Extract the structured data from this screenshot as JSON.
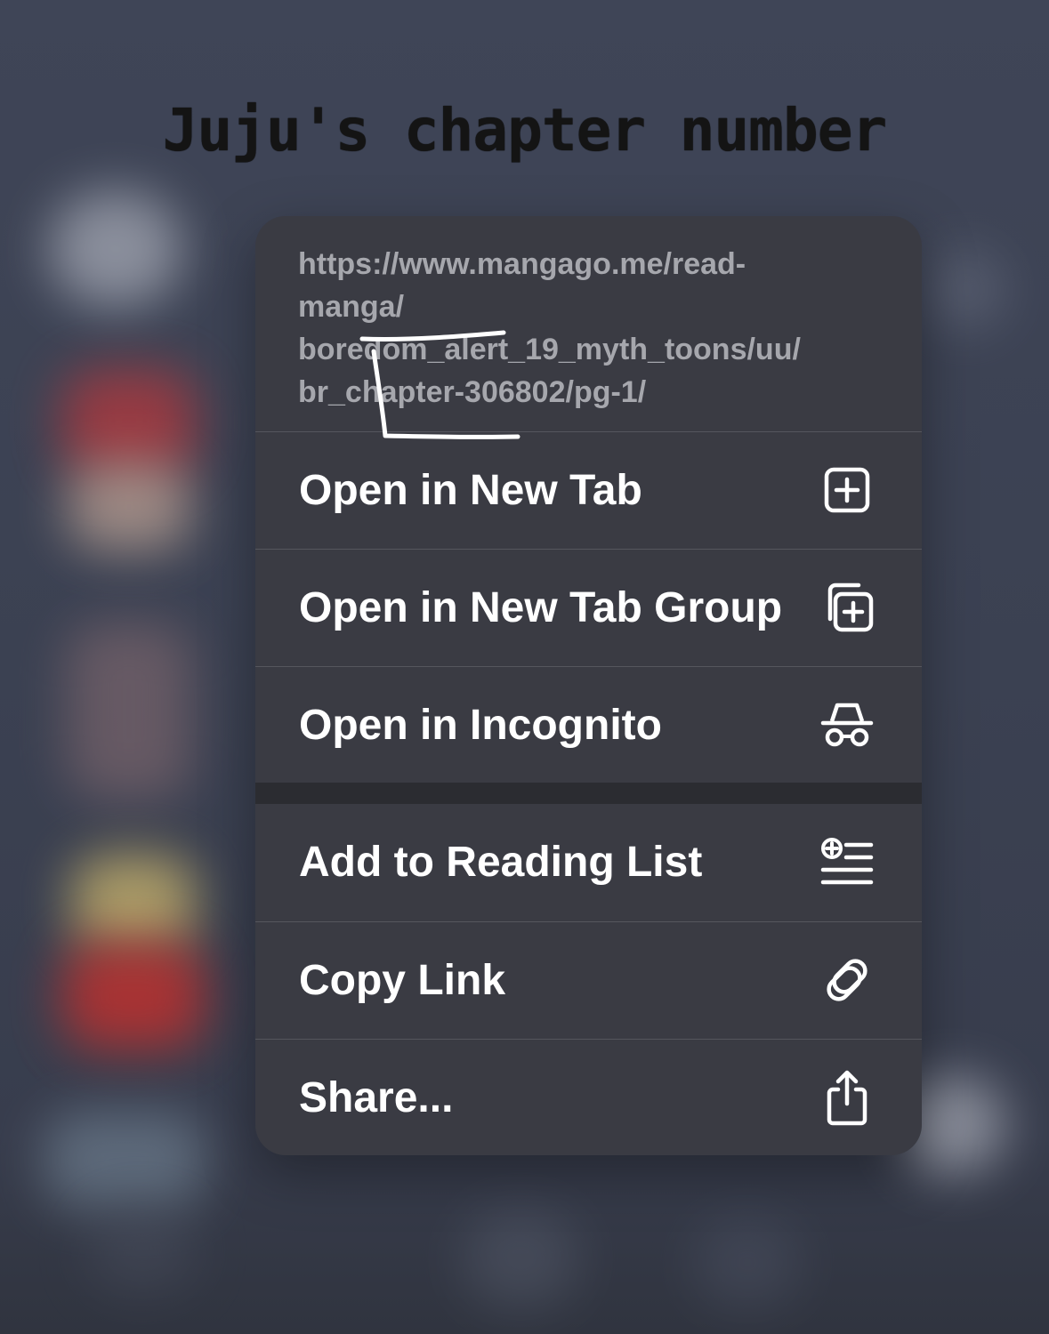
{
  "title": "Juju's chapter number",
  "link_preview": {
    "url_lines": [
      "https://www.mangago.me/read-",
      "manga/",
      "boredom_alert_19_myth_toons/uu/",
      "br_chapter-306802/pg-1/"
    ]
  },
  "menu": {
    "items": [
      {
        "label": "Open in New Tab",
        "icon": "plus-square-icon"
      },
      {
        "label": "Open in New Tab Group",
        "icon": "plus-square-stack-icon"
      },
      {
        "label": "Open in Incognito",
        "icon": "incognito-icon"
      },
      {
        "label": "Add to Reading List",
        "icon": "reading-list-icon"
      },
      {
        "label": "Copy Link",
        "icon": "link-icon"
      },
      {
        "label": "Share...",
        "icon": "share-icon"
      }
    ]
  },
  "colors": {
    "menu_background": "#3a3b43",
    "separator": "#2b2c31",
    "url_text": "#a6a7ad",
    "label_text": "#ffffff"
  }
}
